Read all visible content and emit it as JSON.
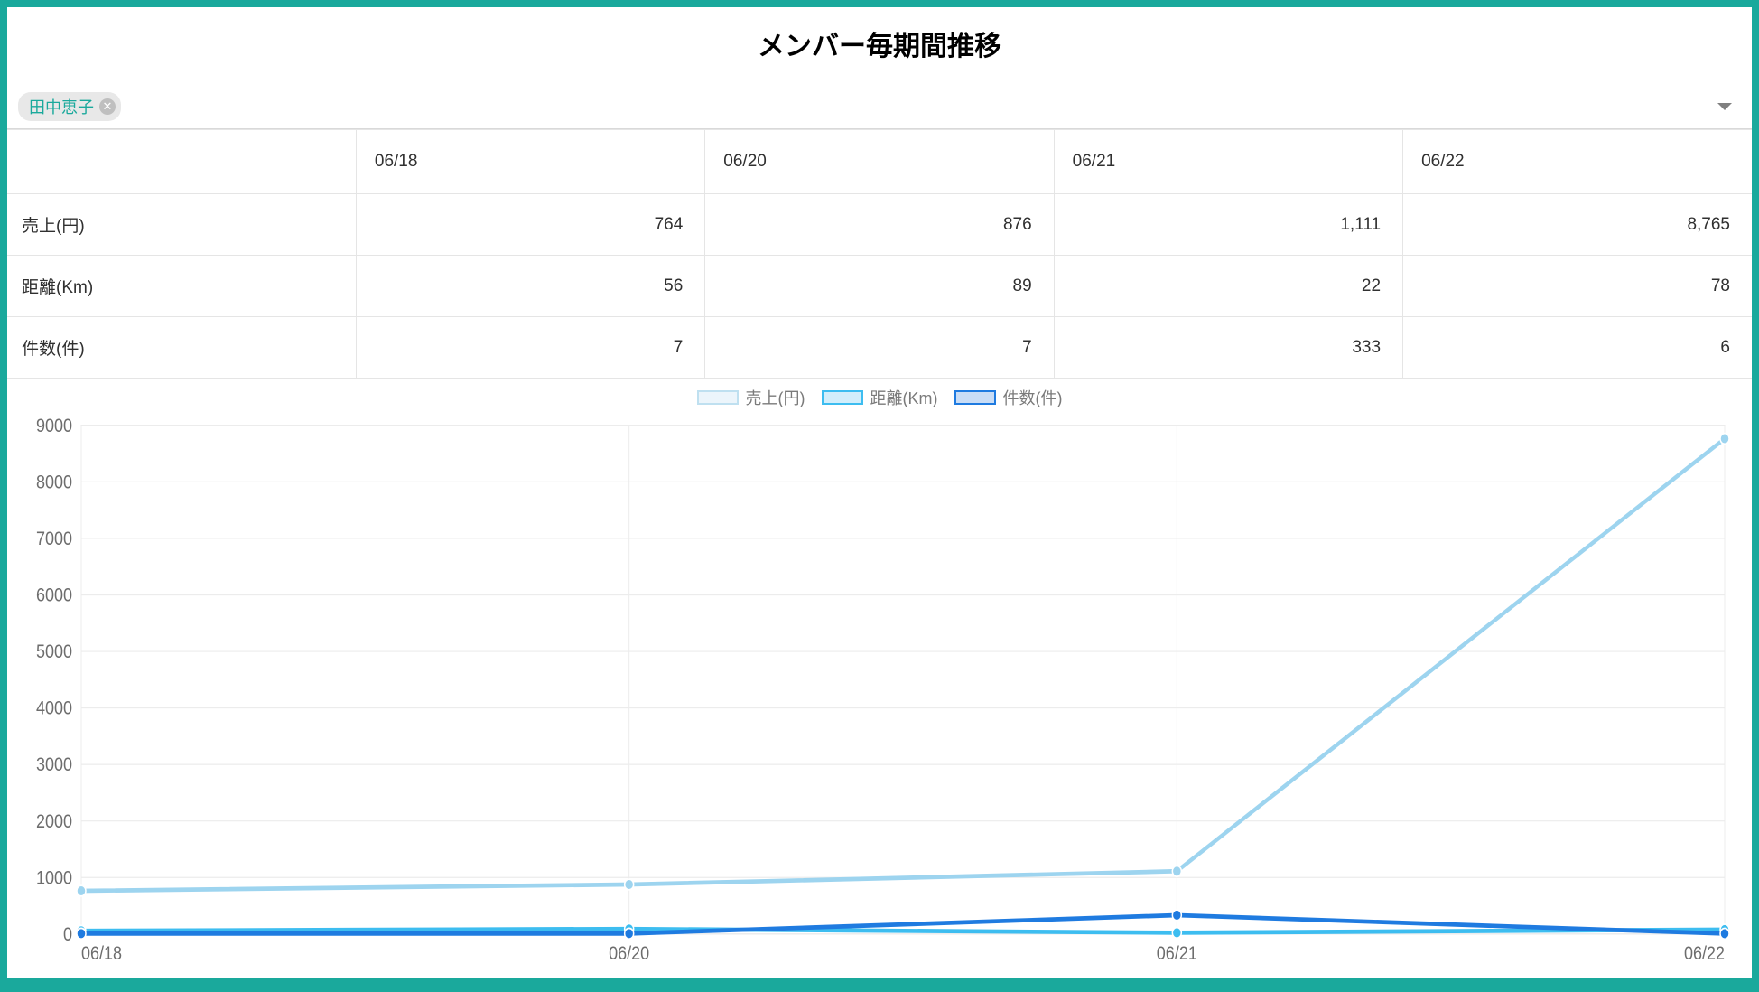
{
  "title": "メンバー毎期間推移",
  "filter": {
    "chips": [
      {
        "label": "田中恵子"
      }
    ]
  },
  "table": {
    "col_label": "",
    "columns": [
      "06/18",
      "06/20",
      "06/21",
      "06/22"
    ],
    "rows": [
      {
        "label": "売上(円)",
        "cells": [
          "764",
          "876",
          "1,111",
          "8,765"
        ]
      },
      {
        "label": "距離(Km)",
        "cells": [
          "56",
          "89",
          "22",
          "78"
        ]
      },
      {
        "label": "件数(件)",
        "cells": [
          "7",
          "7",
          "333",
          "6"
        ]
      }
    ]
  },
  "chart_data": {
    "type": "line",
    "categories": [
      "06/18",
      "06/20",
      "06/21",
      "06/22"
    ],
    "series": [
      {
        "name": "売上(円)",
        "values": [
          764,
          876,
          1111,
          8765
        ],
        "color": "#9dd4ef",
        "legend_border": "#bfe0f0",
        "legend_fill": "#ecf5fb"
      },
      {
        "name": "距離(Km)",
        "values": [
          56,
          89,
          22,
          78
        ],
        "color": "#3dbdf0",
        "legend_border": "#3dbdf0",
        "legend_fill": "#d2eefb"
      },
      {
        "name": "件数(件)",
        "values": [
          7,
          7,
          333,
          6
        ],
        "color": "#1f7be0",
        "legend_border": "#1f7be0",
        "legend_fill": "#c9ddf6"
      }
    ],
    "ylim": [
      0,
      9000
    ],
    "yticks": [
      0,
      1000,
      2000,
      3000,
      4000,
      5000,
      6000,
      7000,
      8000,
      9000
    ],
    "xlabel": "",
    "ylabel": "",
    "title": ""
  }
}
